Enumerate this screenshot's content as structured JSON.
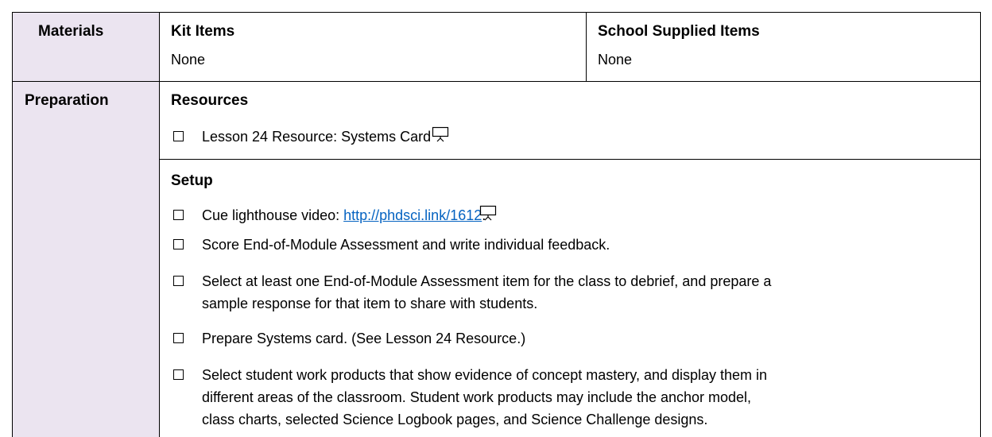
{
  "materials": {
    "label": "Materials",
    "kit_header": "Kit Items",
    "kit_value": "None",
    "school_header": "School Supplied Items",
    "school_value": "None"
  },
  "preparation": {
    "label": "Preparation",
    "resources": {
      "heading": "Resources",
      "items": [
        {
          "text": "Lesson 24 Resource: Systems Card",
          "icon": "projector-icon"
        }
      ]
    },
    "setup": {
      "heading": "Setup",
      "items": [
        {
          "pre": "Cue lighthouse video: ",
          "link": "http://phdsci.link/1612",
          "post": ".",
          "icon": "projector-icon"
        },
        {
          "text": "Score End-of-Module Assessment and write individual feedback."
        },
        {
          "line1": "Select at least one End-of-Module Assessment item for the class to debrief, and prepare a",
          "line2": "sample response for that item to share with students."
        },
        {
          "text": "Prepare Systems card. (See Lesson 24 Resource.)"
        },
        {
          "line1": "Select student work products that show evidence of concept mastery, and display them in",
          "line2": "different areas of the classroom. Student work products may include the anchor model,",
          "line3": "class charts, selected Science Logbook pages, and Science Challenge designs."
        }
      ]
    }
  },
  "colors": {
    "label_cell_bg": "#ebe4f0",
    "link": "#0563c1",
    "border": "#000000"
  }
}
